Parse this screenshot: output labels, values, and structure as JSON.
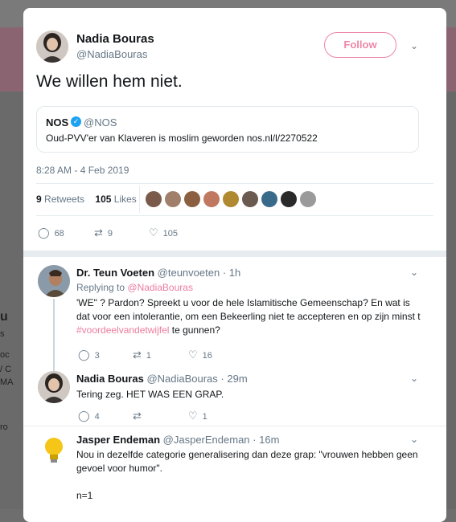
{
  "background": {
    "left_fragments": [
      "u",
      "s",
      "oc",
      "/ C",
      "MA",
      "ro"
    ]
  },
  "main_tweet": {
    "author_name": "Nadia Bouras",
    "author_handle": "@NadiaBouras",
    "follow_label": "Follow",
    "text": "We willen hem niet.",
    "quote": {
      "name": "NOS",
      "handle": "@NOS",
      "text": "Oud-PVV'er van Klaveren is moslim geworden nos.nl/l/2270522"
    },
    "timestamp": "8:28 AM - 4 Feb 2019",
    "retweets_count": "9",
    "retweets_label": "Retweets",
    "likes_count": "105",
    "likes_label": "Likes",
    "actions": {
      "replies": "68",
      "retweets": "9",
      "likes": "105"
    }
  },
  "replies": [
    {
      "name": "Dr. Teun Voeten",
      "handle": "@teunvoeten",
      "time": "1h",
      "replying_to_label": "Replying to",
      "replying_to_handle": "@NadiaBouras",
      "text_before": "'WE\" ? Pardon? Spreekt u voor de hele Islamitische Gemeenschap? En wat is dat voor een intolerantie, om een Bekeerling niet te accepteren en op zijn minst t ",
      "hashtag": "#voordeelvandetwijfel",
      "text_after": " te gunnen?",
      "actions": {
        "replies": "3",
        "retweets": "1",
        "likes": "16"
      }
    },
    {
      "name": "Nadia Bouras",
      "handle": "@NadiaBouras",
      "time": "29m",
      "text": "Tering zeg. HET WAS EEN GRAP.",
      "actions": {
        "replies": "4",
        "retweets": "",
        "likes": "1"
      }
    },
    {
      "name": "Jasper Endeman",
      "handle": "@JasperEndeman",
      "time": "16m",
      "text": "Nou in dezelfde categorie generalisering dan deze grap: \"vrouwen hebben geen gevoel voor humor\".",
      "text2": "n=1"
    }
  ],
  "icons": {
    "reply": "reply-icon",
    "retweet": "retweet-icon",
    "like": "heart-icon",
    "chevron": "chevron-down-icon",
    "verified": "verified-badge-icon"
  },
  "colors": {
    "accent_pink": "#e0245e",
    "verified_blue": "#1da1f2",
    "muted": "#657786"
  }
}
